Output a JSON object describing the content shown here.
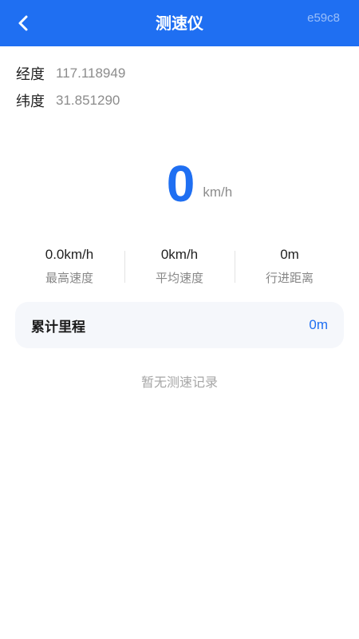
{
  "header": {
    "title": "测速仪",
    "code": "e59c8",
    "back_icon": "chevron-left-icon",
    "background_color": "#1f6ff2"
  },
  "location": {
    "longitude_label": "经度",
    "longitude_value": "117.118949",
    "latitude_label": "纬度",
    "latitude_value": "31.851290"
  },
  "speed": {
    "value": "0",
    "unit": "km/h",
    "color": "#1f6ff2"
  },
  "stats": [
    {
      "value": "0.0km/h",
      "label": "最高速度"
    },
    {
      "value": "0km/h",
      "label": "平均速度"
    },
    {
      "value": "0m",
      "label": "行进距离"
    }
  ],
  "mileage": {
    "label": "累计里程",
    "value": "0m"
  },
  "records": {
    "empty_text": "暂无测速记录"
  }
}
